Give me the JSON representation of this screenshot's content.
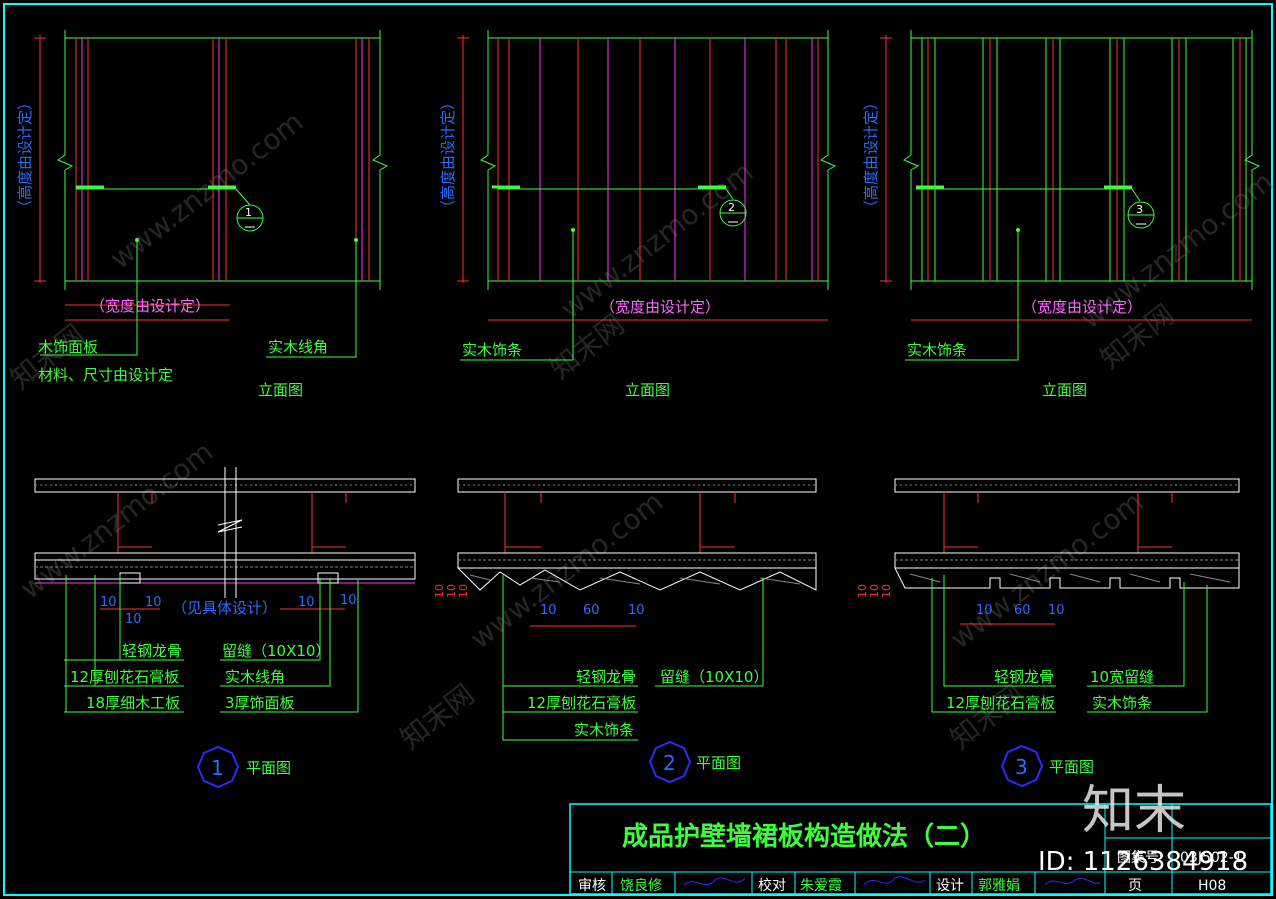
{
  "elevations": {
    "height_label": "（高度由设计定）",
    "width_label": "（宽度由设计定）",
    "title": "立面图",
    "e1": {
      "callout": "1",
      "label_a": "木饰面板",
      "label_b": "材料、尺寸由设计定",
      "label_c": "实木线角"
    },
    "e2": {
      "callout": "2",
      "label_a": "实木饰条"
    },
    "e3": {
      "callout": "3",
      "label_a": "实木饰条"
    }
  },
  "plans": {
    "title": "平面图",
    "p1": {
      "number": "1",
      "dims": [
        "10",
        "10",
        "10",
        "10",
        "10"
      ],
      "note": "（见具体设计）",
      "labels": [
        "轻钢龙骨",
        "12厚刨花石膏板",
        "18厚细木工板",
        "留缝（10X10）",
        "实木线角",
        "3厚饰面板"
      ]
    },
    "p2": {
      "number": "2",
      "dims": [
        "10",
        "60",
        "10"
      ],
      "side_dims": [
        "10",
        "10",
        "10"
      ],
      "labels": [
        "轻钢龙骨",
        "12厚刨花石膏板",
        "实木饰条",
        "留缝（10X10）"
      ]
    },
    "p3": {
      "number": "3",
      "dims": [
        "10",
        "60",
        "10"
      ],
      "side_dims": [
        "10",
        "10",
        "10"
      ],
      "labels": [
        "轻钢龙骨",
        "12厚刨花石膏板",
        "10宽留缝",
        "实木饰条"
      ]
    }
  },
  "title_block": {
    "title": "成品护壁墙裙板构造做法（二）",
    "atlas_label": "图集号",
    "atlas_no": "03J502-1",
    "review_label": "审核",
    "reviewer": "饶良修",
    "check_label": "校对",
    "checker": "朱爱霞",
    "design_label": "设计",
    "designer": "郭雅娟",
    "page_label": "页",
    "page_no": "H08"
  },
  "watermark": {
    "logo": "知末",
    "id": "ID: 1126384918",
    "site": "www.znzmo.com",
    "cn": "知末网"
  },
  "colors": {
    "bg": "#000000",
    "frame": "#00ffff",
    "green": "#3cff3c",
    "red": "#ff3030",
    "magenta": "#ff33ff",
    "blue": "#2b2bff"
  }
}
